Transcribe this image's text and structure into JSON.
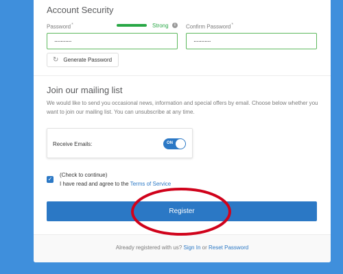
{
  "account_security": {
    "title": "Account Security",
    "password_label": "Password",
    "required_mark": "*",
    "password_value": "...........",
    "strength_text": "Strong",
    "strength_color": "#28a745",
    "confirm_label": "Confirm Password",
    "confirm_value": "...........",
    "generate_button": "Generate Password",
    "generate_icon": "sync-icon"
  },
  "mailing_list": {
    "title": "Join our mailing list",
    "description": "We would like to send you occasional news, information and special offers by email. Choose below whether you want to join our mailing list. You can unsubscribe at any time.",
    "receive_label": "Receive Emails:",
    "toggle_text": "ON",
    "toggle_state": true
  },
  "terms": {
    "checked": true,
    "line1": "(Check to continue)",
    "line2_prefix": "I have read and agree to the",
    "terms_link": "Terms of Service"
  },
  "register_button": "Register",
  "footer": {
    "prefix": "Already registered with us?",
    "sign_in": "Sign In",
    "or": "or",
    "reset": "Reset Password"
  },
  "colors": {
    "background": "#3f8fdc",
    "accent": "#2b78c5",
    "success": "#5cb85c",
    "annotation": "#d0021b"
  }
}
